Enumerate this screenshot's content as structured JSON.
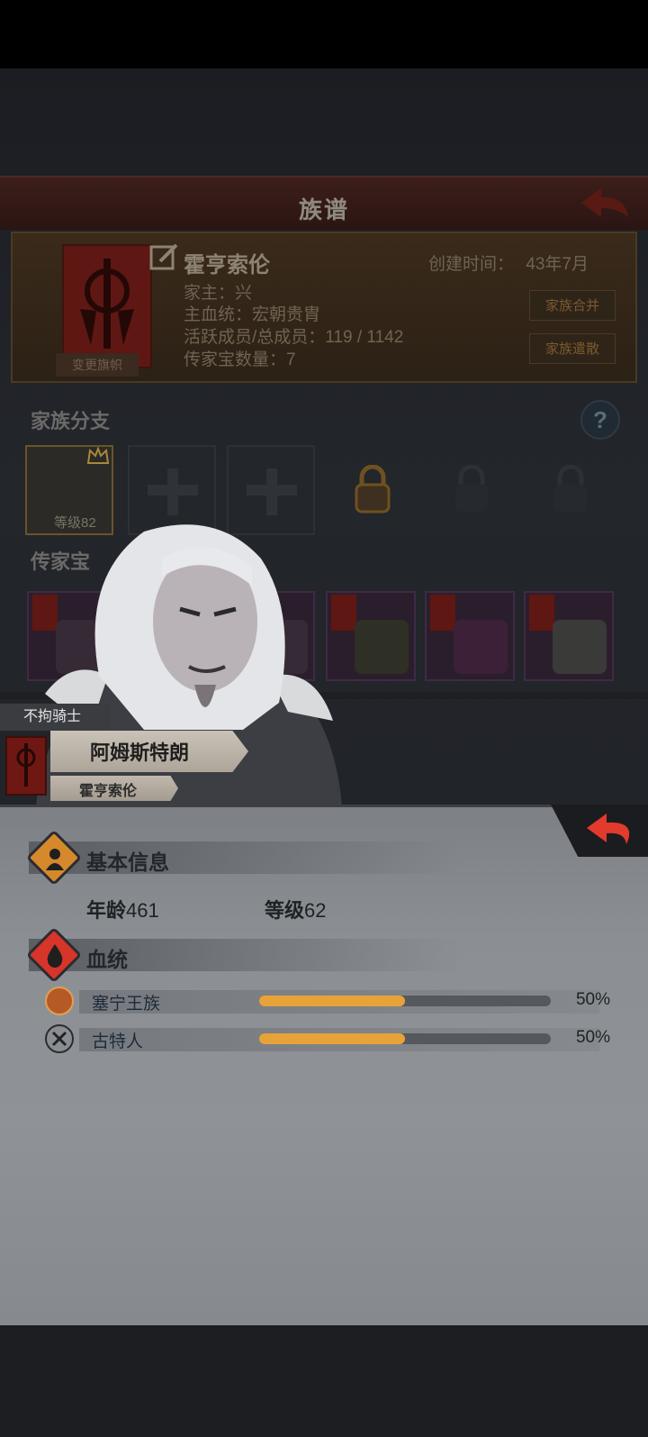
{
  "screen": {
    "title": "族谱"
  },
  "family": {
    "name": "霍亨索伦",
    "created_label": "创建时间：",
    "created_value": "43年7月",
    "head": "家主：兴",
    "bloodline": "主血统：宏朝贵胄",
    "members": "活跃成员/总成员：119 / 1142",
    "heirlooms": "传家宝数量：7",
    "change_banner_label": "变更旗帜",
    "merge_label": "家族合并",
    "disband_label": "家族遣散"
  },
  "branches": {
    "heading": "家族分支",
    "help_glyph": "?",
    "first_level": "等级82"
  },
  "treasures": {
    "heading": "传家宝"
  },
  "character": {
    "title": "不拘骑士",
    "name": "阿姆斯特朗",
    "family": "霍亨索伦"
  },
  "basic_info": {
    "heading": "基本信息",
    "age_label": "年龄",
    "age_value": "461",
    "level_label": "等级",
    "level_value": "62"
  },
  "bloodline": {
    "heading": "血统",
    "rows": [
      {
        "name": "塞宁王族",
        "percent": "50%",
        "fraction": 0.5,
        "icon": "sun-emblem-icon"
      },
      {
        "name": "古特人",
        "percent": "50%",
        "fraction": 0.5,
        "icon": "crossed-axes-icon"
      }
    ]
  },
  "colors": {
    "accent_bar": "#e8a23a",
    "dark_red": "#6f1712"
  }
}
